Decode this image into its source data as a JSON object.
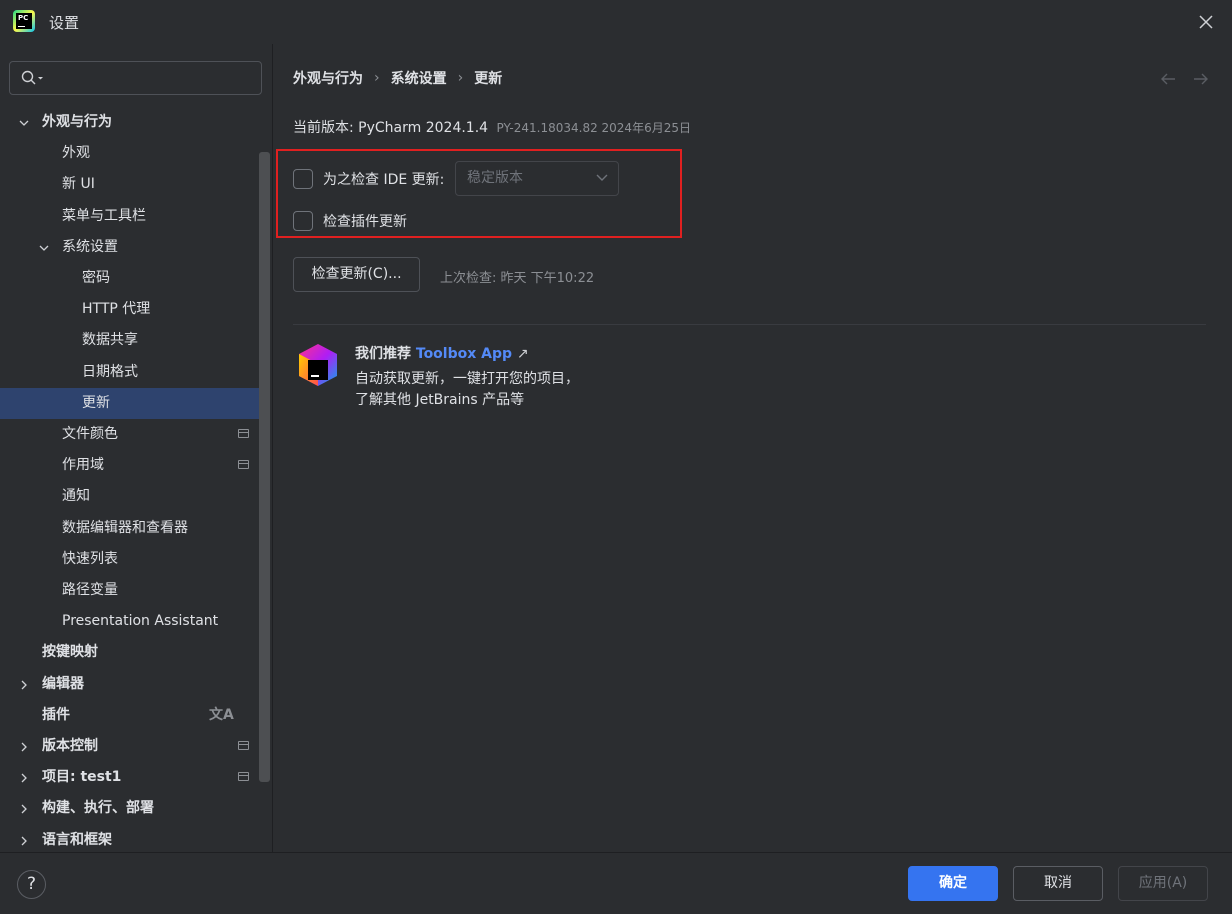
{
  "window": {
    "title": "设置",
    "app_logo_text": "PC"
  },
  "search": {
    "placeholder": ""
  },
  "sidebar": {
    "items": [
      {
        "label": "外观与行为",
        "level": 0,
        "expanded": true,
        "bold": true
      },
      {
        "label": "外观",
        "level": 1
      },
      {
        "label": "新 UI",
        "level": 1
      },
      {
        "label": "菜单与工具栏",
        "level": 1
      },
      {
        "label": "系统设置",
        "level": 1,
        "expanded": true
      },
      {
        "label": "密码",
        "level": 2
      },
      {
        "label": "HTTP 代理",
        "level": 2
      },
      {
        "label": "数据共享",
        "level": 2
      },
      {
        "label": "日期格式",
        "level": 2
      },
      {
        "label": "更新",
        "level": 2,
        "selected": true
      },
      {
        "label": "文件颜色",
        "level": 1,
        "badge": true
      },
      {
        "label": "作用域",
        "level": 1,
        "badge": true
      },
      {
        "label": "通知",
        "level": 1
      },
      {
        "label": "数据编辑器和查看器",
        "level": 1
      },
      {
        "label": "快速列表",
        "level": 1
      },
      {
        "label": "路径变量",
        "level": 1
      },
      {
        "label": "Presentation Assistant",
        "level": 1
      },
      {
        "label": "按键映射",
        "level": 0,
        "bold": true
      },
      {
        "label": "编辑器",
        "level": 0,
        "collapsed": true,
        "bold": true
      },
      {
        "label": "插件",
        "level": 0,
        "bold": true,
        "lang_icon": "文A"
      },
      {
        "label": "版本控制",
        "level": 0,
        "collapsed": true,
        "bold": true,
        "badge": true
      },
      {
        "label": "项目: test1",
        "level": 0,
        "collapsed": true,
        "bold": true,
        "badge": true
      },
      {
        "label": "构建、执行、部署",
        "level": 0,
        "collapsed": true,
        "bold": true
      },
      {
        "label": "语言和框架",
        "level": 0,
        "collapsed": true,
        "bold": true
      }
    ]
  },
  "breadcrumb": [
    "外观与行为",
    "系统设置",
    "更新"
  ],
  "breadcrumb_sep": "›",
  "version": {
    "label": "当前版本: PyCharm 2024.1.4",
    "meta": "PY-241.18034.82 2024年6月25日"
  },
  "updates": {
    "check_ide_label": "为之检查 IDE 更新:",
    "channel_selected": "稳定版本",
    "check_plugins_label": "检查插件更新",
    "check_button": "检查更新(C)...",
    "last_check": "上次检查: 昨天 下午10:22"
  },
  "promo": {
    "title_prefix": "我们推荐 ",
    "link": "Toolbox App",
    "link_arrow": "↗",
    "line1": "自动获取更新，一键打开您的项目，",
    "line2": "了解其他 JetBrains 产品等"
  },
  "footer": {
    "help": "?",
    "ok": "确定",
    "cancel": "取消",
    "apply": "应用(A)"
  },
  "colors": {
    "background": "#2b2d30",
    "selection": "#2e436e",
    "accent": "#3574f0",
    "link": "#548af7",
    "highlight_border": "#e02020"
  }
}
